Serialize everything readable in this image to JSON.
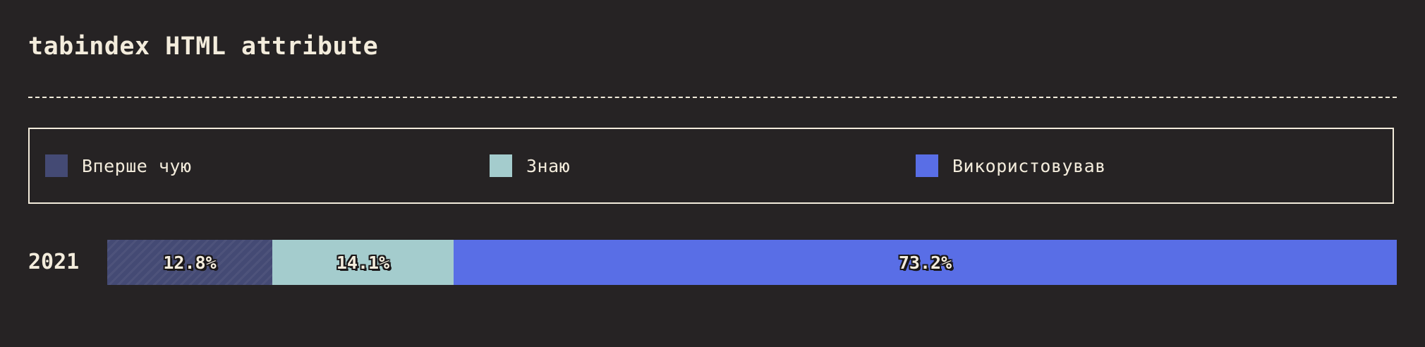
{
  "title": "tabindex HTML attribute",
  "colors": {
    "background": "#262324",
    "text": "#f3ecdc",
    "never_heard": "#444a74",
    "know": "#a4cccd",
    "used": "#596ee6"
  },
  "legend": [
    {
      "label": "Вперше чую",
      "color": "#444a74"
    },
    {
      "label": "Знаю",
      "color": "#a4cccd"
    },
    {
      "label": "Використовував",
      "color": "#596ee6"
    }
  ],
  "chart_data": {
    "type": "bar",
    "orientation": "horizontal",
    "stacked": true,
    "normalized": true,
    "title": "tabindex HTML attribute",
    "categories": [
      "2021"
    ],
    "series": [
      {
        "name": "Вперше чую",
        "values": [
          12.8
        ],
        "label": "12.8%"
      },
      {
        "name": "Знаю",
        "values": [
          14.1
        ],
        "label": "14.1%"
      },
      {
        "name": "Використовував",
        "values": [
          73.2
        ],
        "label": "73.2%"
      }
    ],
    "legend_position": "top",
    "grid": false
  }
}
